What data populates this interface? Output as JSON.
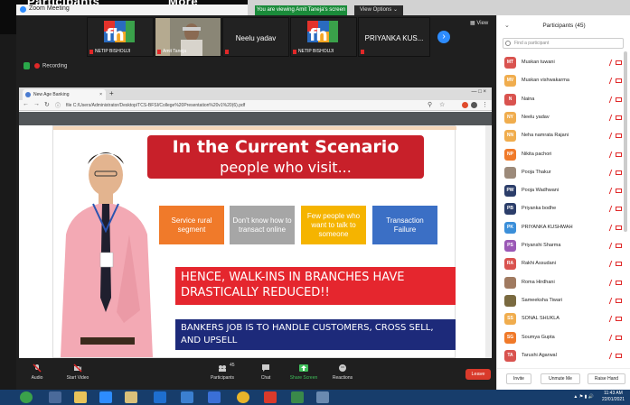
{
  "app": {
    "title": "Zoom Meeting"
  },
  "overlay_tabs": [
    "Participants",
    "More"
  ],
  "banner": {
    "viewing": "You are viewing Amit Taneja's screen",
    "view_options": "View Options ⌄"
  },
  "thumbnails": [
    {
      "name": "NETIP BISHOUJI",
      "logo": "fh"
    },
    {
      "name": "Amit Taneja",
      "logo": ""
    },
    {
      "name": "Neelu yadav",
      "logo": ""
    },
    {
      "name": "NETIP BISHOUJI",
      "logo": "fh"
    },
    {
      "name": "PRIYANKA KUS...",
      "logo": ""
    }
  ],
  "view_label": "View",
  "recording_label": "Recording",
  "browser": {
    "tab_title": "New Age Banking",
    "url": "file  C:/Users/Administrator/Desktop/TCS-BFSI/College%20Presentation%20v1%20(6).pdf"
  },
  "slide": {
    "title_line1": "In the Current Scenario",
    "title_line2": "people who visit...",
    "cards": [
      {
        "label": "Service rural segment",
        "color": "#f07a2a"
      },
      {
        "label": "Don't know how to transact online",
        "color": "#a6a6a6"
      },
      {
        "label": "Few people who want to talk to someone",
        "color": "#f5b400"
      },
      {
        "label": "Transaction Failure",
        "color": "#3b6fc5"
      }
    ],
    "walkins": "HENCE, WALK-INS IN BRANCHES HAVE DRASTICALLY REDUCED!!",
    "bankers": "BANKERS JOB IS TO HANDLE CUSTOMERS, CROSS SELL, AND UPSELL"
  },
  "toolbar": {
    "audio": "Audio",
    "start_video": "Start Video",
    "participants": "Participants",
    "participants_count": "45",
    "chat": "Chat",
    "share_screen": "Share Screen",
    "reactions": "Reactions",
    "leave": "Leave"
  },
  "participants_panel": {
    "title": "Participants (45)",
    "search_placeholder": "Find a participant",
    "list": [
      {
        "initials": "MT",
        "name": "Muskan tuwani",
        "color": "#d9534f"
      },
      {
        "initials": "MV",
        "name": "Muskan vishwakarma",
        "color": "#f0ad4e"
      },
      {
        "initials": "N",
        "name": "Naina",
        "color": "#d9534f"
      },
      {
        "initials": "NY",
        "name": "Neelu yadav",
        "color": "#f0ad4e"
      },
      {
        "initials": "NN",
        "name": "Neha namrata Rajani",
        "color": "#f0ad4e"
      },
      {
        "initials": "NP",
        "name": "Nikita pachori",
        "color": "#f07a2a"
      },
      {
        "initials": "",
        "name": "Pooja Thakur",
        "color": "#9c8a7a"
      },
      {
        "initials": "PW",
        "name": "Pooja Wadhwani",
        "color": "#2c3e6a"
      },
      {
        "initials": "PB",
        "name": "Priyanka bodhe",
        "color": "#2c3e6a"
      },
      {
        "initials": "PK",
        "name": "PRIYANKA KUSHWAH",
        "color": "#3b8fd9"
      },
      {
        "initials": "PS",
        "name": "Priyanshi Sharma",
        "color": "#9b59b6"
      },
      {
        "initials": "RA",
        "name": "Rakhi Assudani",
        "color": "#d9534f"
      },
      {
        "initials": "",
        "name": "Roma Hirdhani",
        "color": "#a07a60"
      },
      {
        "initials": "",
        "name": "Sameeksha Tiwari",
        "color": "#7a6a40"
      },
      {
        "initials": "SS",
        "name": "SONAL SHUKLA",
        "color": "#f0ad4e"
      },
      {
        "initials": "SG",
        "name": "Soumya Gupta",
        "color": "#f07a2a"
      },
      {
        "initials": "TA",
        "name": "Tarushi Agarwal",
        "color": "#d9534f"
      }
    ],
    "invite": "Invite",
    "unmute_me": "Unmute Me",
    "raise_hand": "Raise Hand"
  },
  "taskbar": {
    "time": "11:43 AM",
    "date": "22/01/2021"
  }
}
